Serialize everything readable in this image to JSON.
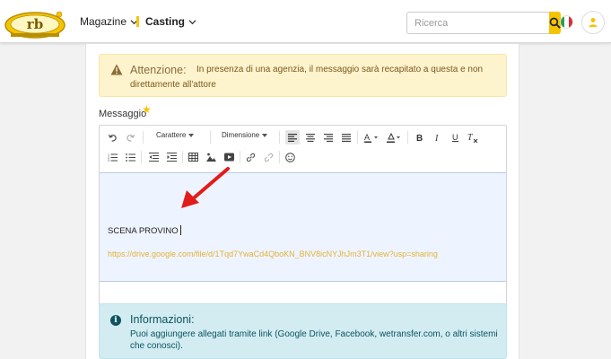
{
  "header": {
    "nav": [
      {
        "label": "Magazine"
      },
      {
        "label": "Casting"
      }
    ],
    "search": {
      "placeholder": "Ricerca",
      "value": ""
    },
    "accent_color": "#f5c400"
  },
  "warning": {
    "title": "Attenzione:",
    "text_line1": "In presenza di una agenzia, il messaggio sarà recapitato a questa e non",
    "text_line2": "direttamente all'attore"
  },
  "message_field": {
    "label": "Messaggio",
    "required_mark": "★",
    "toolbar": {
      "font_label": "Carattere",
      "size_label": "Dimensione"
    },
    "body_text": "SCENA PROVINO",
    "body_link": "https://drive.google.com/file/d/1Tqd7YwaCd4QboKN_BNV8icNYJhJm3T1/view?usp=sharing"
  },
  "info": {
    "title": "Informazioni:",
    "text_line1": "Puoi aggiungere allegati tramite link (Google Drive, Facebook, wetransfer.com, o altri sistemi",
    "text_line2": "che conosci)."
  }
}
